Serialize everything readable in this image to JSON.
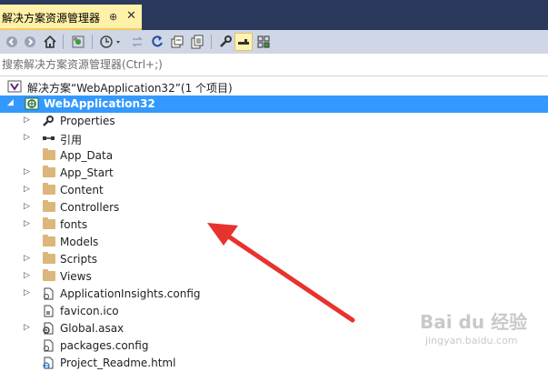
{
  "panel": {
    "title": "解决方案资源管理器",
    "pin_glyph": "⊕",
    "close_glyph": "✕"
  },
  "toolbar": {
    "buttons": [
      "back-icon",
      "forward-icon",
      "home-icon",
      "sync-icon",
      "history-icon",
      "swap-icon",
      "refresh-icon",
      "collapse-all-icon",
      "show-all-files-icon",
      "properties-wrench-icon",
      "preview-icon",
      "class-view-icon"
    ]
  },
  "search": {
    "placeholder": "搜索解决方案资源管理器(Ctrl+;)"
  },
  "tree": {
    "solution_label": "解决方案“WebApplication32”(1 个项目)",
    "project_label": "WebApplication32",
    "items": [
      {
        "label": "Properties"
      },
      {
        "label": "引用"
      },
      {
        "label": "App_Data"
      },
      {
        "label": "App_Start"
      },
      {
        "label": "Content"
      },
      {
        "label": "Controllers"
      },
      {
        "label": "fonts"
      },
      {
        "label": "Models"
      },
      {
        "label": "Scripts"
      },
      {
        "label": "Views"
      },
      {
        "label": "ApplicationInsights.config"
      },
      {
        "label": "favicon.ico"
      },
      {
        "label": "Global.asax"
      },
      {
        "label": "packages.config"
      },
      {
        "label": "Project_Readme.html"
      }
    ]
  },
  "colors": {
    "titlebar": "#2b3a5c",
    "active_tab": "#fff1a8",
    "selection": "#3399ff",
    "arrow": "#e8322d"
  },
  "watermark": {
    "brand": "Bai du 经验",
    "url": "jingyan.baidu.com"
  }
}
